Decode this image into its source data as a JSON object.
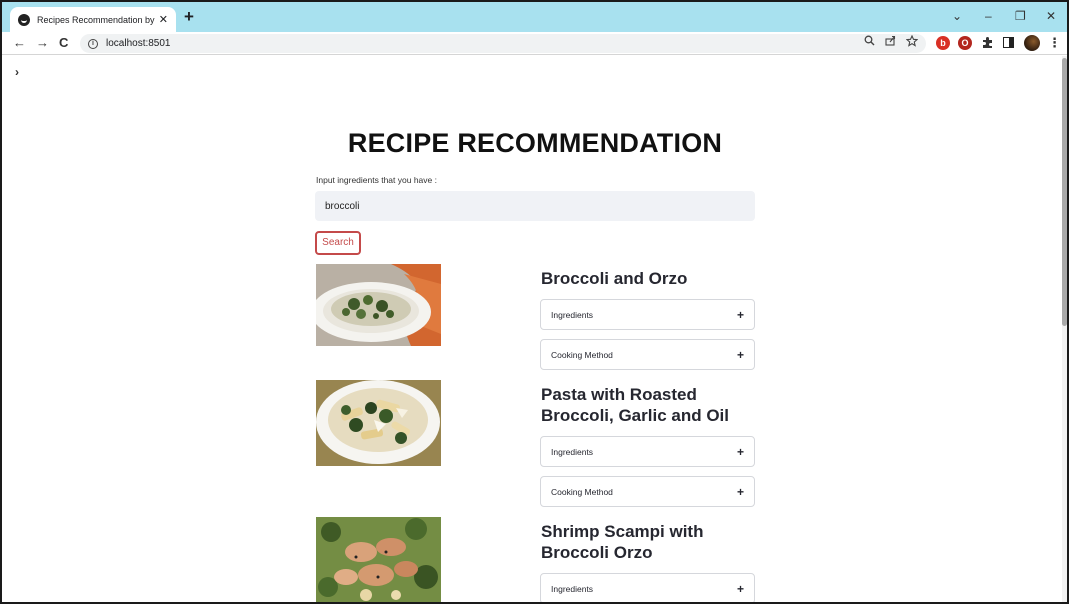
{
  "browser": {
    "tab_title": "Recipes Recommendation by Epi",
    "tab_close": "✕",
    "new_tab": "+",
    "url": "localhost:8501",
    "nav": {
      "back": "←",
      "forward": "→",
      "reload": "C"
    },
    "window_controls": {
      "dropdown": "⌄",
      "minimize": "–",
      "restore": "❐",
      "close": "✕"
    },
    "omnibox_icons": [
      "zoom-icon",
      "share-icon",
      "bookmark-star-icon"
    ],
    "extensions": [
      "extension-1-icon",
      "extension-2-icon",
      "puzzle-icon",
      "side-panel-icon",
      "profile-avatar"
    ],
    "menu": "⋮"
  },
  "app": {
    "sidebar_toggle": "›",
    "title": "RECIPE RECOMMENDATION",
    "input_label": "Input ingredients that you have :",
    "input_value": "broccoli",
    "search_label": "Search",
    "accent_color": "#c44a4a"
  },
  "recipes": [
    {
      "title": "Broccoli and Orzo",
      "expanders": [
        {
          "label": "Ingredients",
          "icon": "+"
        },
        {
          "label": "Cooking Method",
          "icon": "+"
        }
      ]
    },
    {
      "title": "Pasta with Roasted Broccoli, Garlic and Oil",
      "expanders": [
        {
          "label": "Ingredients",
          "icon": "+"
        },
        {
          "label": "Cooking Method",
          "icon": "+"
        }
      ]
    },
    {
      "title": "Shrimp Scampi with Broccoli Orzo",
      "expanders": [
        {
          "label": "Ingredients",
          "icon": "+"
        }
      ]
    }
  ]
}
